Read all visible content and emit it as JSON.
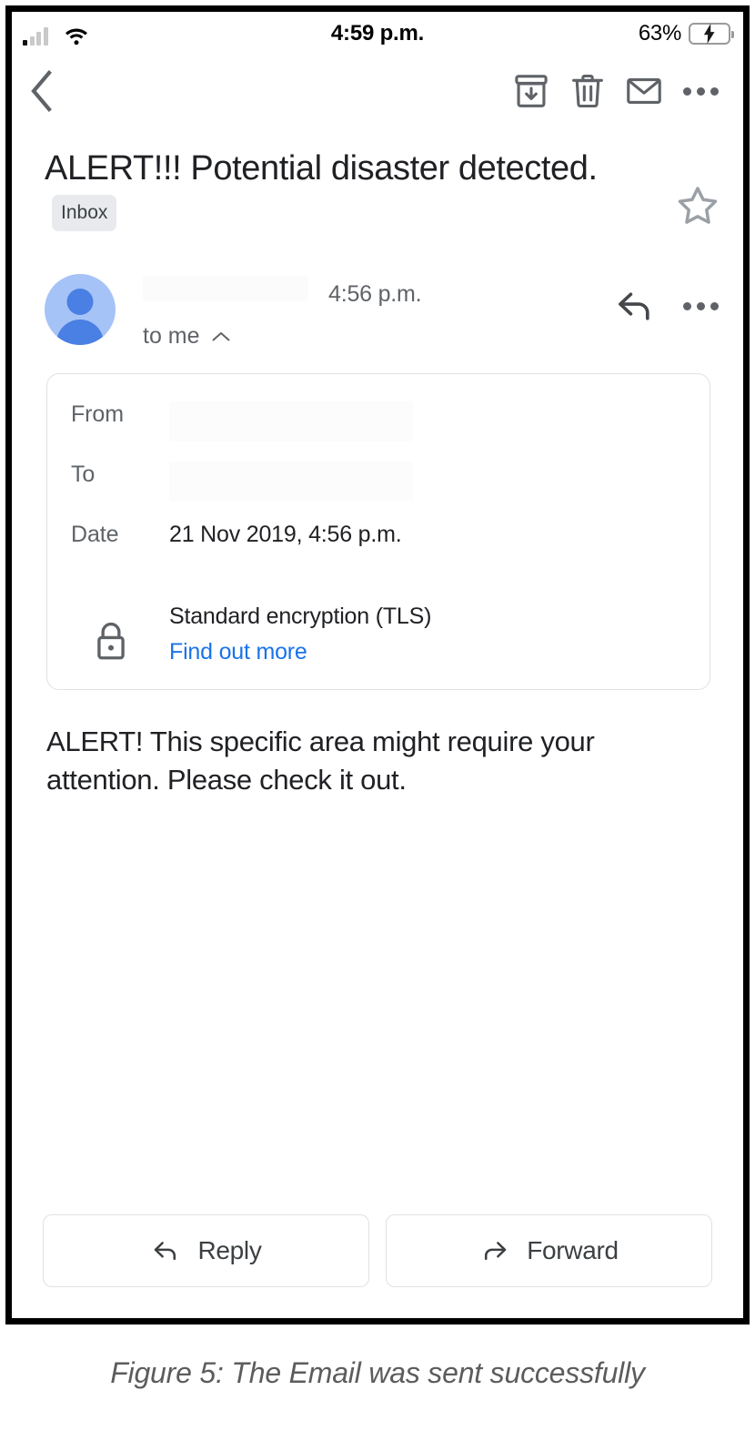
{
  "status_bar": {
    "time": "4:59 p.m.",
    "battery_percent": "63%",
    "battery_level": 63,
    "charging": true,
    "signal_bars_filled": 1,
    "signal_bars_total": 4,
    "wifi": "wifi-icon"
  },
  "toolbar": {
    "back_label": "back-arrow",
    "archive_label": "archive",
    "delete_label": "delete",
    "mark_unread_label": "mark-unread",
    "more_label": "more-options"
  },
  "header": {
    "subject": "ALERT!!! Potential disaster detected.",
    "label_chip": "Inbox",
    "starred": false
  },
  "sender": {
    "name": "",
    "name_redacted": true,
    "time": "4:56 p.m.",
    "recipients": "to me",
    "expanded": true,
    "reply_label": "reply",
    "more_label": "more-options"
  },
  "details": {
    "from_label": "From",
    "from_value": "",
    "to_label": "To",
    "to_value": "",
    "date_label": "Date",
    "date_value": "21 Nov 2019, 4:56 p.m.",
    "encryption_text": "Standard encryption (TLS)",
    "encryption_link": "Find out more",
    "link_color": "#1a73e8"
  },
  "body": {
    "text": "ALERT! This specific area might require your attention. Please check it out."
  },
  "actions": {
    "reply": "Reply",
    "forward": "Forward"
  },
  "caption": {
    "text": "Figure 5: The Email was sent successfully"
  },
  "colors": {
    "accent_link": "#1a73e8",
    "avatar_bg": "#a6c3f7",
    "avatar_fg": "#4a7fe3",
    "battery_green": "#33d158",
    "icon_gray": "#5f6368",
    "text_primary": "#202124",
    "chip_bg": "#e8eaed"
  }
}
